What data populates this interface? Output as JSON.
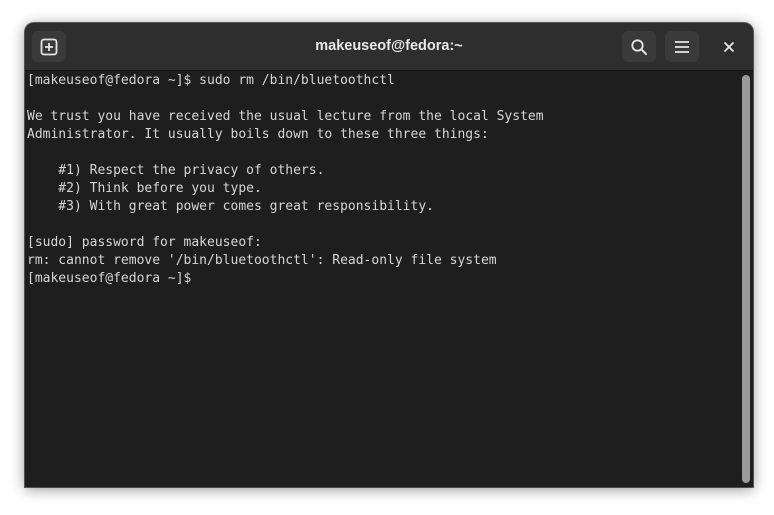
{
  "window": {
    "title": "makeuseof@fedora:~"
  },
  "toolbar": {
    "new_tab_icon": "new-tab-icon",
    "search_icon": "search-icon",
    "menu_icon": "hamburger-menu-icon",
    "close_icon": "close-icon"
  },
  "terminal": {
    "lines": [
      "[makeuseof@fedora ~]$ sudo rm /bin/bluetoothctl",
      "",
      "We trust you have received the usual lecture from the local System",
      "Administrator. It usually boils down to these three things:",
      "",
      "    #1) Respect the privacy of others.",
      "    #2) Think before you type.",
      "    #3) With great power comes great responsibility.",
      "",
      "[sudo] password for makeuseof:",
      "rm: cannot remove '/bin/bluetoothctl': Read-only file system",
      "[makeuseof@fedora ~]$ "
    ]
  },
  "colors": {
    "background": "#1e1e1e",
    "titlebar": "#2e2e2e",
    "text": "#d6d6d6"
  }
}
